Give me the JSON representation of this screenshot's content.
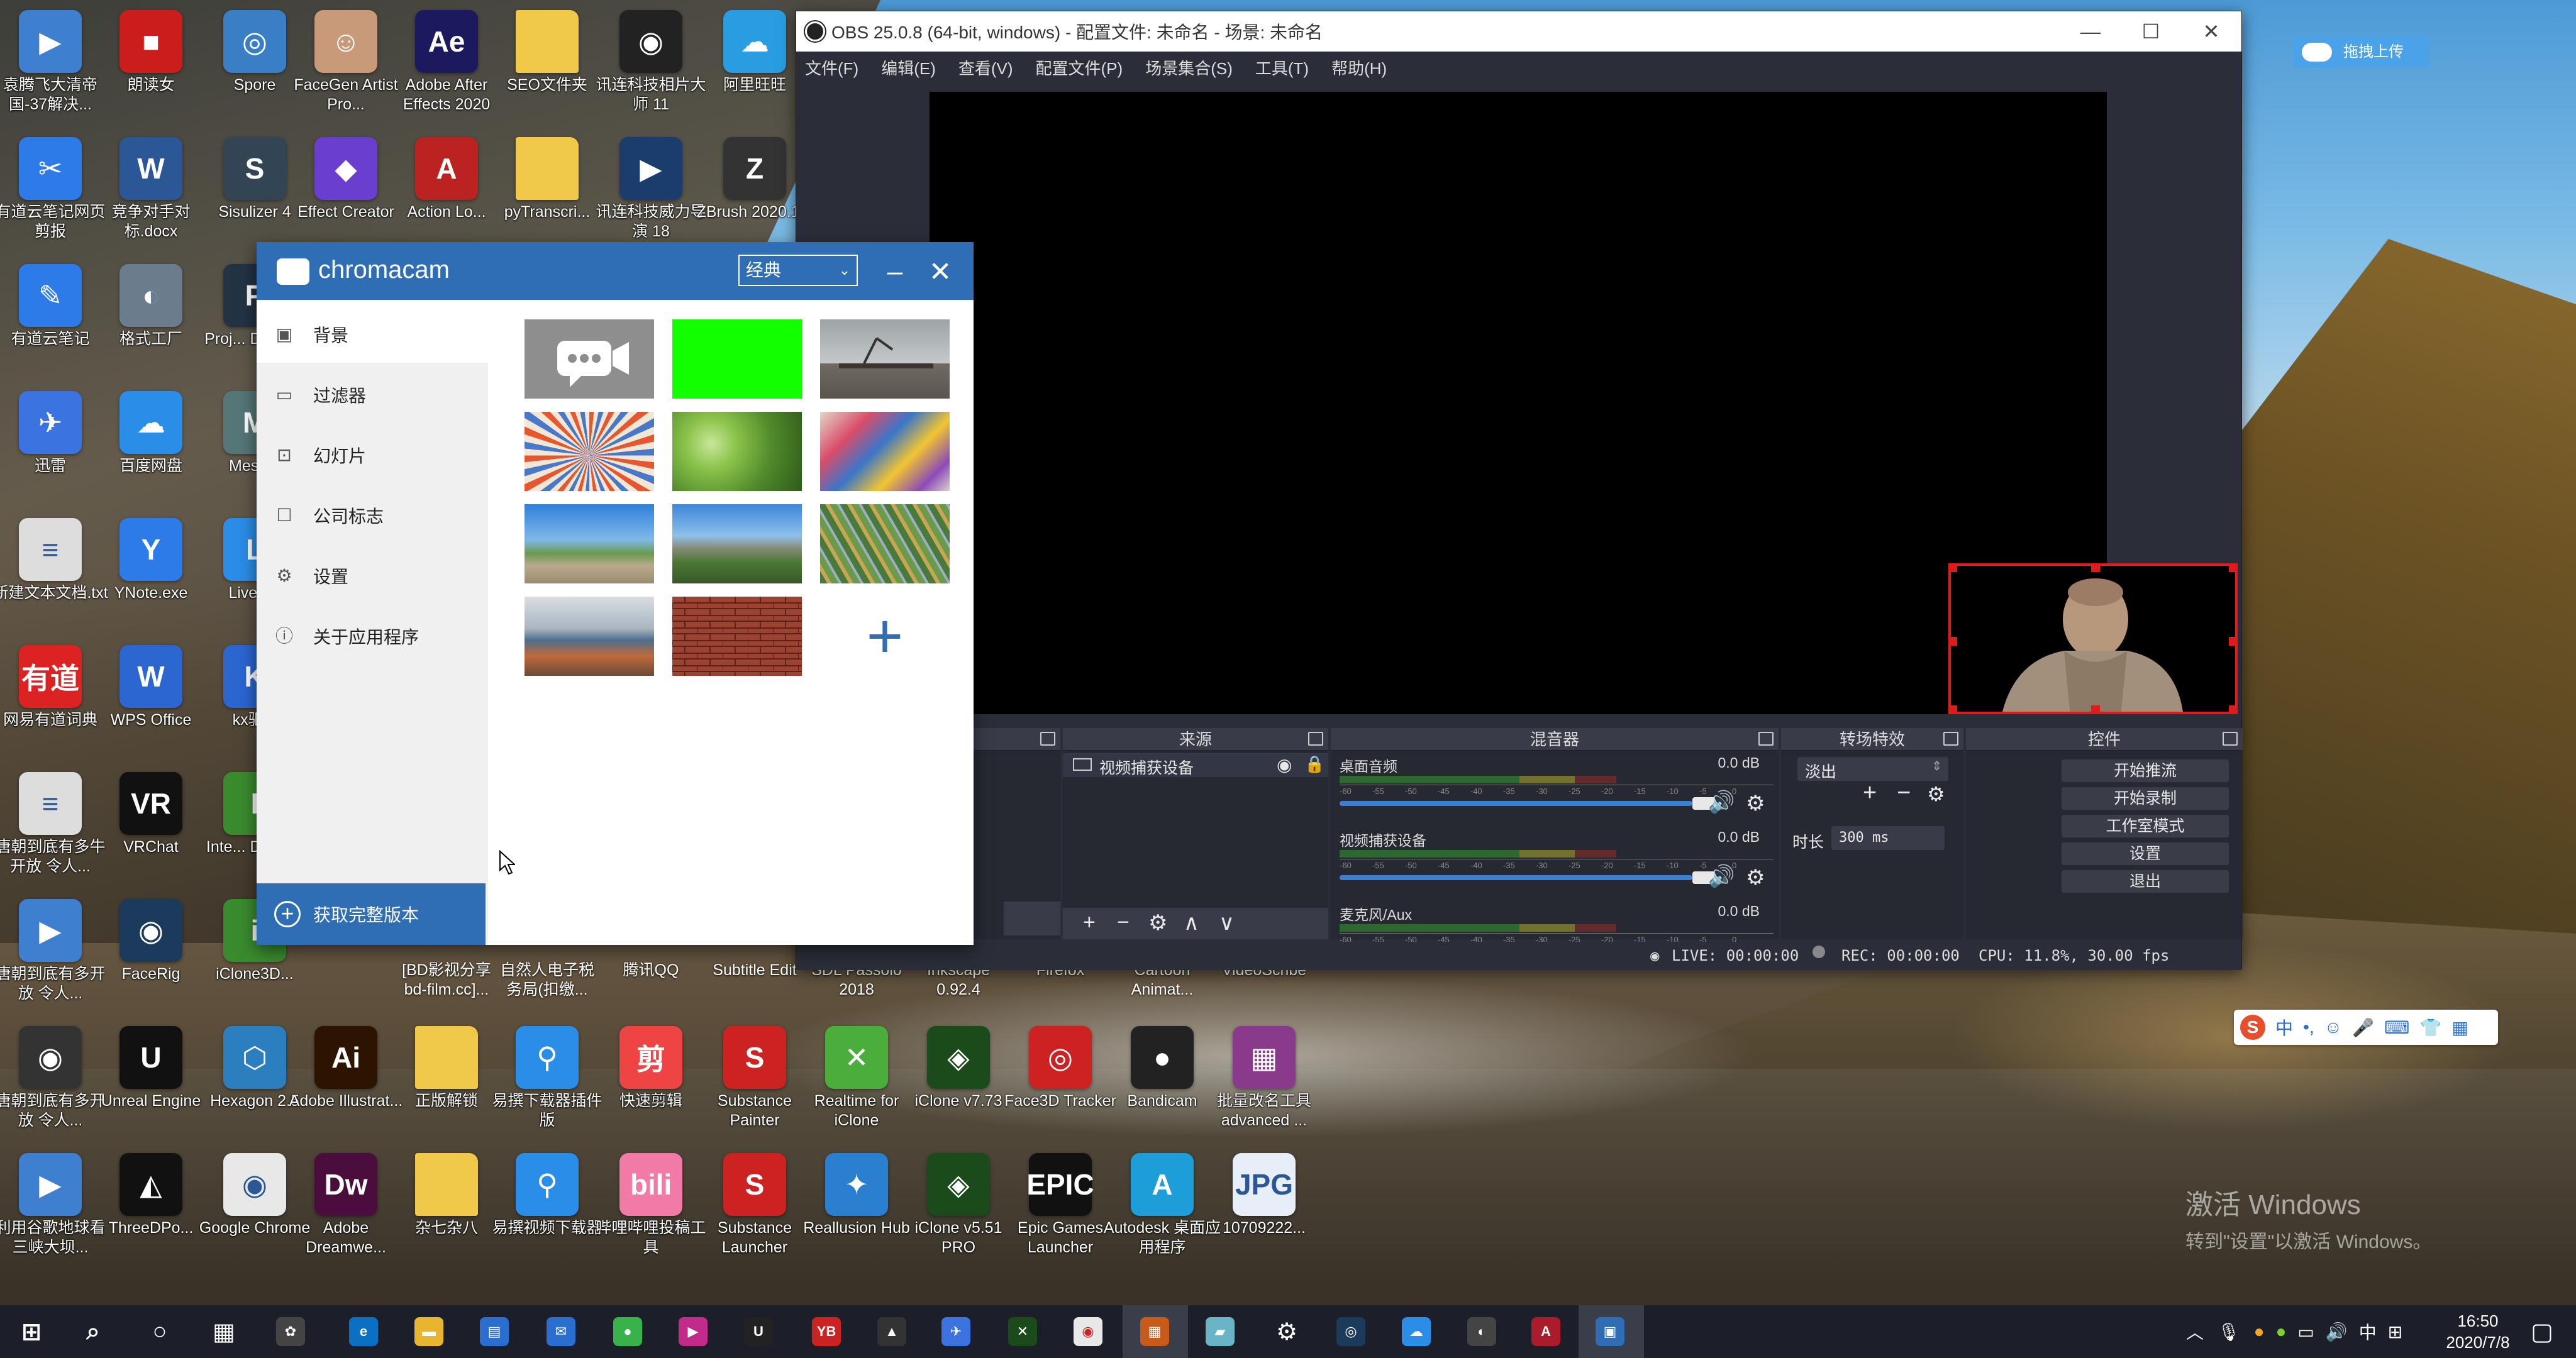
{
  "desktop": {
    "icons": [
      {
        "label": "袁腾飞大清帝国-37解决...",
        "color": "#3f7fcf",
        "glyph": "▶"
      },
      {
        "label": "朗读女",
        "color": "#cc1d1d",
        "glyph": "■"
      },
      {
        "label": "Spore",
        "color": "#3a7fc6",
        "glyph": "◎"
      },
      {
        "label": "FaceGen Artist Pro...",
        "color": "#c89a7a",
        "glyph": "☺"
      },
      {
        "label": "Adobe After Effects 2020",
        "color": "#1b1a5e",
        "glyph": "Ae"
      },
      {
        "label": "SEO文件夹",
        "color": "#f1c94a",
        "glyph": ""
      },
      {
        "label": "讯连科技相片大师 11",
        "color": "#222",
        "glyph": "◉"
      },
      {
        "label": "阿里旺旺",
        "color": "#2a9de2",
        "glyph": "☁"
      },
      {
        "label": "有道云笔记网页剪报",
        "color": "#2d7be8",
        "glyph": "✂"
      },
      {
        "label": "竞争对手对标.docx",
        "color": "#2b5797",
        "glyph": "W"
      },
      {
        "label": "Sisulizer 4",
        "color": "#345",
        "glyph": "S"
      },
      {
        "label": "Effect Creator",
        "color": "#6a3fcf",
        "glyph": "◆"
      },
      {
        "label": "Action Lo...",
        "color": "#b22",
        "glyph": "A"
      },
      {
        "label": "pyTranscri...",
        "color": "#f1c94a",
        "glyph": ""
      },
      {
        "label": "讯连科技威力导演 18",
        "color": "#1a3d6e",
        "glyph": "▶"
      },
      {
        "label": "ZBrush 2020.1.1",
        "color": "#333",
        "glyph": "Z"
      },
      {
        "label": "有道云笔记",
        "color": "#2d7be8",
        "glyph": "✎"
      },
      {
        "label": "格式工厂",
        "color": "#6b7d8c",
        "glyph": "◐"
      },
      {
        "label": "Proj... Darkn...",
        "color": "#234",
        "glyph": "P"
      },
      {
        "label": "迅雷",
        "color": "#3b73e0",
        "glyph": "✈"
      },
      {
        "label": "百度网盘",
        "color": "#2a8de8",
        "glyph": "☁"
      },
      {
        "label": "Mesh...",
        "color": "#577",
        "glyph": "M"
      },
      {
        "label": "新建文本文档.txt",
        "color": "#ddd",
        "glyph": "≡"
      },
      {
        "label": "YNote.exe",
        "color": "#2d7be8",
        "glyph": "Y"
      },
      {
        "label": "LiveS...",
        "color": "#2a8de8",
        "glyph": "L"
      },
      {
        "label": "网易有道词典",
        "color": "#d22",
        "glyph": "有道"
      },
      {
        "label": "WPS Office",
        "color": "#2b66d1",
        "glyph": "W"
      },
      {
        "label": "kx驱...",
        "color": "#2b66d1",
        "glyph": "K"
      },
      {
        "label": "唐朝到底有多牛开放 令人...",
        "color": "#ddd",
        "glyph": "≡"
      },
      {
        "label": "VRChat",
        "color": "#111",
        "glyph": "VR"
      },
      {
        "label": "Inte... Down...",
        "color": "#3a8b2e",
        "glyph": "I"
      },
      {
        "label": "唐朝到底有多开放 令人...",
        "color": "#3f7fcf",
        "glyph": "▶"
      },
      {
        "label": "FaceRig",
        "color": "#1b3a5c",
        "glyph": "◉"
      },
      {
        "label": "iClone3D...",
        "color": "#3a8b2e",
        "glyph": "i"
      },
      {
        "label": "唐朝到底有多开放 令人...",
        "color": "#333",
        "glyph": "◉"
      },
      {
        "label": "Unreal Engine",
        "color": "#111",
        "glyph": "U"
      },
      {
        "label": "Hexagon 2.5",
        "color": "#2b7fbf",
        "glyph": "⬡"
      },
      {
        "label": "Adobe Illustrat...",
        "color": "#2d1400",
        "glyph": "Ai"
      },
      {
        "label": "正版解锁",
        "color": "#f1c94a",
        "glyph": ""
      },
      {
        "label": "易撰下载器插件版",
        "color": "#2a8de8",
        "glyph": "⚲"
      },
      {
        "label": "快速剪辑",
        "color": "#e44",
        "glyph": "剪"
      },
      {
        "label": "Substance Painter",
        "color": "#c22",
        "glyph": "S"
      },
      {
        "label": "Realtime for iClone",
        "color": "#4cae3a",
        "glyph": "✕"
      },
      {
        "label": "iClone v7.73",
        "color": "#1b4a1b",
        "glyph": "◈"
      },
      {
        "label": "Face3D Tracker",
        "color": "#c22",
        "glyph": "◎"
      },
      {
        "label": "Bandicam",
        "color": "#222",
        "glyph": "●"
      },
      {
        "label": "批量改名工具 advanced ...",
        "color": "#8a3a8a",
        "glyph": "▦"
      },
      {
        "label": "利用谷歌地球看三峡大坝...",
        "color": "#3f7fcf",
        "glyph": "▶"
      },
      {
        "label": "ThreeDPo...",
        "color": "#111",
        "glyph": "◭"
      },
      {
        "label": "Google Chrome",
        "color": "#e8e8e8",
        "glyph": "◉"
      },
      {
        "label": "Adobe Dreamwe...",
        "color": "#4a0d3c",
        "glyph": "Dw"
      },
      {
        "label": "杂七杂八",
        "color": "#f1c94a",
        "glyph": ""
      },
      {
        "label": "易撰视频下载器",
        "color": "#2a8de8",
        "glyph": "⚲"
      },
      {
        "label": "哔哩哔哩投稿工具",
        "color": "#f27aa7",
        "glyph": "bili"
      },
      {
        "label": "Substance Launcher",
        "color": "#c22",
        "glyph": "S"
      },
      {
        "label": "Reallusion Hub",
        "color": "#2a7fd0",
        "glyph": "✦"
      },
      {
        "label": "iClone v5.51 PRO",
        "color": "#1b4a1b",
        "glyph": "◈"
      },
      {
        "label": "Epic Games Launcher",
        "color": "#111",
        "glyph": "EPIC"
      },
      {
        "label": "Autodesk 桌面应用程序",
        "color": "#1e9ed8",
        "glyph": "A"
      },
      {
        "label": "10709222...",
        "color": "#e8eef8",
        "glyph": "JPG"
      },
      {
        "label": "[BD影视分享bd-film.cc]...",
        "color": "#3f7fcf",
        "glyph": ""
      },
      {
        "label": "自然人电子税务局(扣缴...",
        "color": "#c22",
        "glyph": ""
      },
      {
        "label": "腾讯QQ",
        "color": "#111",
        "glyph": ""
      },
      {
        "label": "Subtitle Edit",
        "color": "#444",
        "glyph": ""
      },
      {
        "label": "SDL Passolo 2018",
        "color": "#3a6",
        "glyph": ""
      },
      {
        "label": "Inkscape 0.92.4",
        "color": "#333",
        "glyph": ""
      },
      {
        "label": "Firefox",
        "color": "#e66",
        "glyph": ""
      },
      {
        "label": "Cartoon Animat...",
        "color": "#48c",
        "glyph": ""
      },
      {
        "label": "VideoScribe",
        "color": "#e84",
        "glyph": ""
      }
    ]
  },
  "obs": {
    "title": "OBS 25.0.8 (64-bit, windows) - 配置文件: 未命名 - 场景: 未命名",
    "menu": [
      "文件(F)",
      "编辑(E)",
      "查看(V)",
      "配置文件(P)",
      "场景集合(S)",
      "工具(T)",
      "帮助(H)"
    ],
    "docks": {
      "sources": "来源",
      "mixer": "混音器",
      "transitions": "转场特效",
      "controls": "控件"
    },
    "sources": [
      {
        "name": "视频捕获设备"
      }
    ],
    "mixer": [
      {
        "name": "桌面音频",
        "db": "0.0 dB",
        "level": 0.85
      },
      {
        "name": "视频捕获设备",
        "db": "0.0 dB",
        "level": 0.85
      },
      {
        "name": "麦克风/Aux",
        "db": "0.0 dB",
        "level": 0.85
      }
    ],
    "mixer_ticks": [
      "-60",
      "-55",
      "-50",
      "-45",
      "-40",
      "-35",
      "-30",
      "-25",
      "-20",
      "-15",
      "-10",
      "-5",
      "0"
    ],
    "transition": {
      "selected": "淡出",
      "duration_label": "时长",
      "duration_value": "300 ms"
    },
    "controls": [
      "开始推流",
      "开始录制",
      "工作室模式",
      "设置",
      "退出"
    ],
    "status": {
      "live": "LIVE: 00:00:00",
      "rec": "REC: 00:00:00",
      "cpu": "CPU: 11.8%, 30.00 fps"
    }
  },
  "chromacam": {
    "title": "chromacam",
    "mode": "经典",
    "nav": [
      {
        "label": "背景",
        "icon": "image-icon",
        "selected": true
      },
      {
        "label": "过滤器",
        "icon": "filter-icon",
        "selected": false
      },
      {
        "label": "幻灯片",
        "icon": "slideshow-icon",
        "selected": false
      },
      {
        "label": "公司标志",
        "icon": "logo-icon",
        "selected": false
      },
      {
        "label": "设置",
        "icon": "gear-icon",
        "selected": false
      },
      {
        "label": "关于应用程序",
        "icon": "info-icon",
        "selected": false
      }
    ],
    "upgrade_label": "获取完整版本",
    "backgrounds": [
      "chromacam-logo",
      "green-screen",
      "office-desk",
      "sunburst",
      "bokeh-green",
      "paint-splash",
      "palm-street",
      "mountain-palms",
      "palm-leaves",
      "office-interior",
      "brick-wall"
    ],
    "colors": {
      "brand": "#2f6db4"
    }
  },
  "upload_chip": "拖拽上传",
  "ime": {
    "lang": "中"
  },
  "activate": {
    "line1": "激活 Windows",
    "line2": "转到\"设置\"以激活 Windows。"
  },
  "taskbar": {
    "clock_time": "16:50",
    "clock_date": "2020/7/8",
    "tray_lang": "中"
  }
}
